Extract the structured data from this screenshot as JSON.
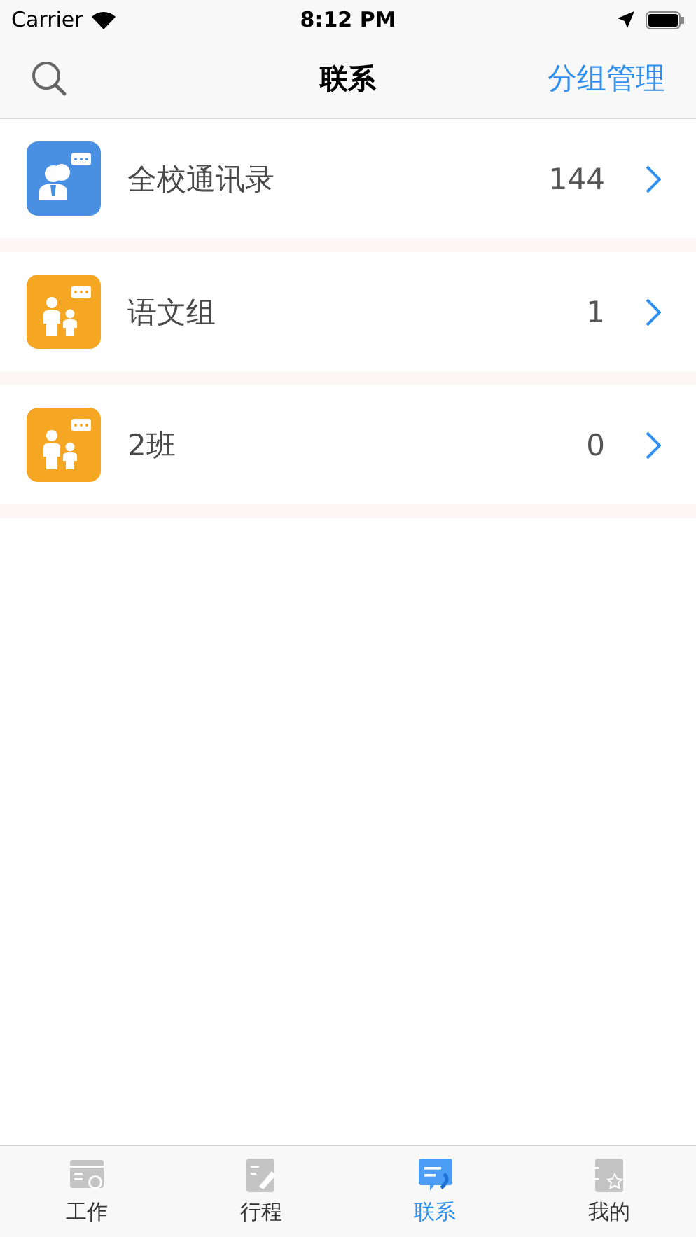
{
  "status_bar": {
    "carrier": "Carrier",
    "time": "8:12 PM"
  },
  "nav": {
    "title": "联系",
    "action": "分组管理"
  },
  "rows": [
    {
      "kind": "directory",
      "name": "全校通讯录",
      "count": "144"
    },
    {
      "kind": "group",
      "name": "语文组",
      "count": "1"
    },
    {
      "kind": "group",
      "name": "2班",
      "count": "0"
    }
  ],
  "tabs": [
    {
      "kind": "work",
      "label": "工作",
      "selected": false
    },
    {
      "kind": "schedule",
      "label": "行程",
      "selected": false
    },
    {
      "kind": "contacts",
      "label": "联系",
      "selected": true
    },
    {
      "kind": "me",
      "label": "我的",
      "selected": false
    }
  ]
}
